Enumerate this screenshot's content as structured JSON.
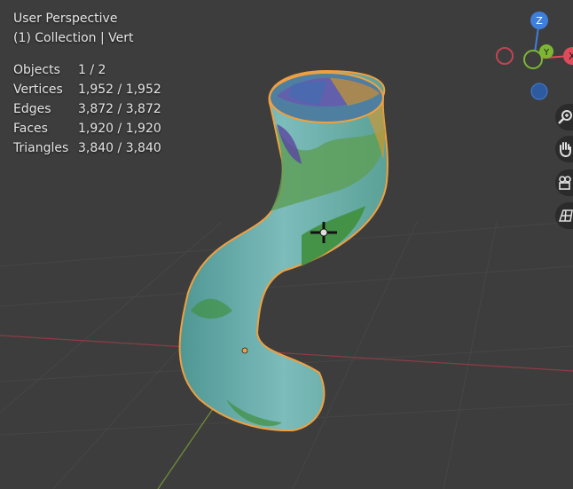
{
  "viewport": {
    "view_name": "User Perspective",
    "collection": "(1) Collection | Vert"
  },
  "stats": [
    {
      "label": "Objects",
      "value": "1 / 2"
    },
    {
      "label": "Vertices",
      "value": "1,952 / 1,952"
    },
    {
      "label": "Edges",
      "value": "3,872 / 3,872"
    },
    {
      "label": "Faces",
      "value": "1,920 / 1,920"
    },
    {
      "label": "Triangles",
      "value": "3,840 / 3,840"
    }
  ],
  "gizmo": {
    "z_label": "Z",
    "y_label": "Y",
    "x_label": "X",
    "colors": {
      "x": "#e04b5b",
      "y": "#7cb734",
      "z": "#3f7fdc"
    }
  },
  "nav_icons": [
    "zoom-icon",
    "pan-hand-icon",
    "camera-icon",
    "grid-icon"
  ],
  "colors": {
    "background": "#3d3d3d",
    "selection_outline": "#f0a040",
    "mesh_base": "#5fa7a6"
  }
}
